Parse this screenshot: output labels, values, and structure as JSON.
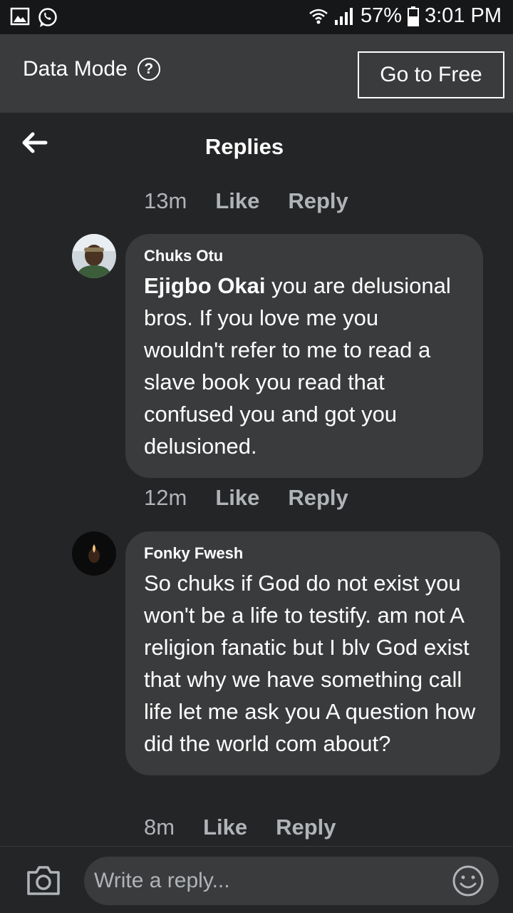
{
  "status_bar": {
    "icons_left": [
      "gallery-icon",
      "whatsapp-icon"
    ],
    "icons_right": [
      "wifi-icon",
      "signal-icon",
      "battery-icon"
    ],
    "battery": "57%",
    "time": "3:01 PM"
  },
  "data_mode": {
    "label": "Data Mode",
    "help_icon": "?",
    "button": "Go to Free"
  },
  "header": {
    "title": "Replies",
    "back_icon": "back-arrow-icon"
  },
  "thread": {
    "top_meta": {
      "time": "13m",
      "like": "Like",
      "reply": "Reply"
    },
    "comments": [
      {
        "author": "Chuks Otu",
        "mention": "Ejigbo Okai",
        "text": " you are delusional bros. If you love me you wouldn't refer to me to read a slave book you read that confused you and got you delusioned.",
        "meta": {
          "time": "12m",
          "like": "Like",
          "reply": "Reply"
        }
      },
      {
        "author": "Fonky Fwesh",
        "text": "So chuks if God do not exist you won't be a life to testify. am not A religion fanatic but I blv God exist that why we have something call life let me ask you A question how did the world com about?",
        "meta": {
          "time": "8m",
          "like": "Like",
          "reply": "Reply"
        }
      }
    ]
  },
  "composer": {
    "placeholder": "Write a reply...",
    "camera_icon": "camera-icon",
    "emoji_icon": "emoji-icon"
  }
}
